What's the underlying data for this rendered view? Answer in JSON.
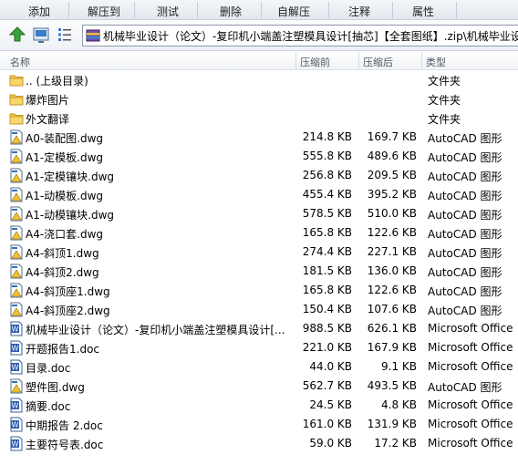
{
  "toolbar": {
    "items": [
      "添加",
      "解压到",
      "测试",
      "删除",
      "自解压",
      "注释",
      "属性"
    ]
  },
  "address": {
    "path": "机械毕业设计（论文）-复印机小端盖注塑模具设计[抽芯]【全套图纸】.zip\\机械毕业设"
  },
  "columns": {
    "name": "名称",
    "size": "压缩前",
    "packed": "压缩后",
    "type": "类型"
  },
  "files": [
    {
      "name": ".. (上级目录)",
      "size": "",
      "packed": "",
      "type": "文件夹",
      "icon": "folder-icon"
    },
    {
      "name": "爆炸图片",
      "size": "",
      "packed": "",
      "type": "文件夹",
      "icon": "folder-icon"
    },
    {
      "name": "外文翻译",
      "size": "",
      "packed": "",
      "type": "文件夹",
      "icon": "folder-icon"
    },
    {
      "name": "A0-装配图.dwg",
      "size": "214.8 KB",
      "packed": "169.7 KB",
      "type": "AutoCAD 图形",
      "icon": "dwg-icon"
    },
    {
      "name": "A1-定模板.dwg",
      "size": "555.8 KB",
      "packed": "489.6 KB",
      "type": "AutoCAD 图形",
      "icon": "dwg-icon"
    },
    {
      "name": "A1-定模镶块.dwg",
      "size": "256.8 KB",
      "packed": "209.5 KB",
      "type": "AutoCAD 图形",
      "icon": "dwg-icon"
    },
    {
      "name": "A1-动模板.dwg",
      "size": "455.4 KB",
      "packed": "395.2 KB",
      "type": "AutoCAD 图形",
      "icon": "dwg-icon"
    },
    {
      "name": "A1-动模镶块.dwg",
      "size": "578.5 KB",
      "packed": "510.0 KB",
      "type": "AutoCAD 图形",
      "icon": "dwg-icon"
    },
    {
      "name": "A4-浇口套.dwg",
      "size": "165.8 KB",
      "packed": "122.6 KB",
      "type": "AutoCAD 图形",
      "icon": "dwg-icon"
    },
    {
      "name": "A4-斜顶1.dwg",
      "size": "274.4 KB",
      "packed": "227.1 KB",
      "type": "AutoCAD 图形",
      "icon": "dwg-icon"
    },
    {
      "name": "A4-斜顶2.dwg",
      "size": "181.5 KB",
      "packed": "136.0 KB",
      "type": "AutoCAD 图形",
      "icon": "dwg-icon"
    },
    {
      "name": "A4-斜顶座1.dwg",
      "size": "165.8 KB",
      "packed": "122.6 KB",
      "type": "AutoCAD 图形",
      "icon": "dwg-icon"
    },
    {
      "name": "A4-斜顶座2.dwg",
      "size": "150.4 KB",
      "packed": "107.6 KB",
      "type": "AutoCAD 图形",
      "icon": "dwg-icon"
    },
    {
      "name": "机械毕业设计（论文）-复印机小端盖注塑模具设计[...",
      "size": "988.5 KB",
      "packed": "626.1 KB",
      "type": "Microsoft Office",
      "icon": "doc-icon"
    },
    {
      "name": "开题报告1.doc",
      "size": "221.0 KB",
      "packed": "167.9 KB",
      "type": "Microsoft Office",
      "icon": "doc-icon"
    },
    {
      "name": "目录.doc",
      "size": "44.0 KB",
      "packed": "9.1 KB",
      "type": "Microsoft Office",
      "icon": "doc-icon"
    },
    {
      "name": "塑件图.dwg",
      "size": "562.7 KB",
      "packed": "493.5 KB",
      "type": "AutoCAD 图形",
      "icon": "dwg-icon"
    },
    {
      "name": "摘要.doc",
      "size": "24.5 KB",
      "packed": "4.8 KB",
      "type": "Microsoft Office",
      "icon": "doc-icon"
    },
    {
      "name": "中期报告 2.doc",
      "size": "161.0 KB",
      "packed": "131.9 KB",
      "type": "Microsoft Office",
      "icon": "doc-icon"
    },
    {
      "name": "主要符号表.doc",
      "size": "59.0 KB",
      "packed": "17.2 KB",
      "type": "Microsoft Office",
      "icon": "doc-icon"
    }
  ]
}
